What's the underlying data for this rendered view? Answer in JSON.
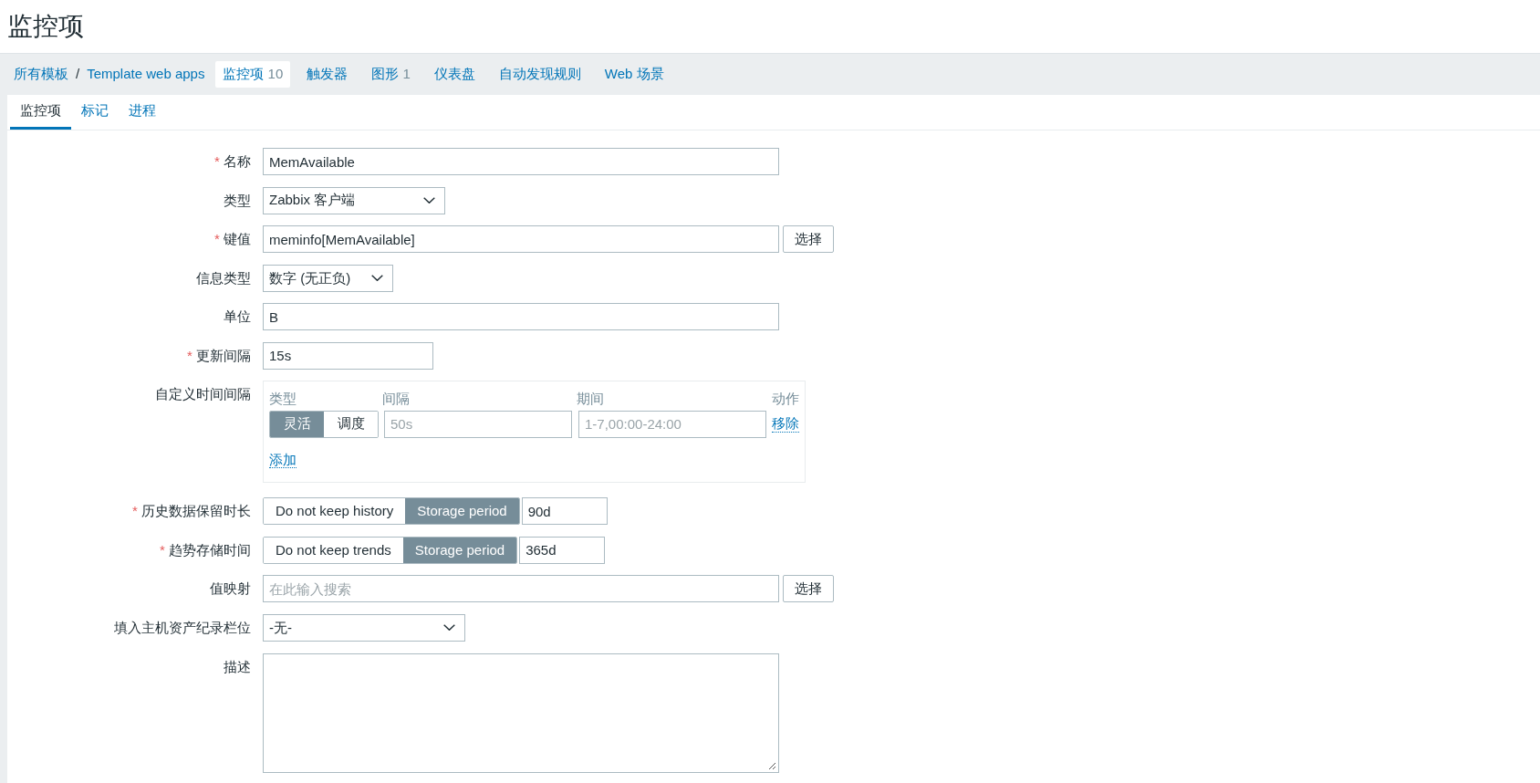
{
  "page_title": "监控项",
  "required_mark": "*",
  "breadcrumb": {
    "items": [
      {
        "label": "所有模板"
      },
      {
        "label": "Template web apps"
      }
    ],
    "separator": "/"
  },
  "nav": [
    {
      "label": "监控项",
      "count": "10",
      "selected": true
    },
    {
      "label": "触发器",
      "selected": false
    },
    {
      "label": "图形",
      "count": "1",
      "selected": false
    },
    {
      "label": "仪表盘",
      "selected": false
    },
    {
      "label": "自动发现规则",
      "selected": false
    },
    {
      "label": "Web 场景",
      "selected": false
    }
  ],
  "tabs": [
    {
      "label": "监控项",
      "selected": true
    },
    {
      "label": "标记",
      "selected": false
    },
    {
      "label": "进程",
      "selected": false
    }
  ],
  "form": [
    {
      "kind": "text",
      "label": "名称",
      "required": true,
      "value": "MemAvailable"
    },
    {
      "kind": "select",
      "label": "类型",
      "required": false,
      "value": "Zabbix 客户端"
    },
    {
      "kind": "text",
      "label": "键值",
      "required": true,
      "value": "meminfo[MemAvailable]",
      "button": "选择"
    },
    {
      "kind": "select",
      "label": "信息类型",
      "required": false,
      "value": "数字 (无正负)"
    },
    {
      "kind": "text",
      "label": "单位",
      "required": false,
      "value": "B"
    },
    {
      "kind": "text",
      "label": "更新间隔",
      "required": true,
      "value": "15s"
    },
    {
      "kind": "intervals",
      "label": "自定义时间间隔",
      "required": false,
      "columns": [
        "类型",
        "间隔",
        "期间",
        "动作"
      ],
      "rows": [
        {
          "modes": [
            {
              "label": "灵活",
              "selected": true
            },
            {
              "label": "调度",
              "selected": false
            }
          ],
          "interval_placeholder": "50s",
          "period_placeholder": "1-7,00:00-24:00",
          "action": "移除"
        }
      ],
      "add": "添加"
    },
    {
      "kind": "storage",
      "label": "历史数据保留时长",
      "required": true,
      "options": [
        {
          "label": "Do not keep history",
          "selected": false
        },
        {
          "label": "Storage period",
          "selected": true
        }
      ],
      "value": "90d"
    },
    {
      "kind": "storage",
      "label": "趋势存储时间",
      "required": true,
      "options": [
        {
          "label": "Do not keep trends",
          "selected": false
        },
        {
          "label": "Storage period",
          "selected": true
        }
      ],
      "value": "365d"
    },
    {
      "kind": "text",
      "label": "值映射",
      "required": false,
      "placeholder": "在此输入搜索",
      "button": "选择"
    },
    {
      "kind": "select",
      "label": "填入主机资产纪录栏位",
      "required": false,
      "value": "-无-"
    },
    {
      "kind": "textarea",
      "label": "描述",
      "required": false
    }
  ]
}
